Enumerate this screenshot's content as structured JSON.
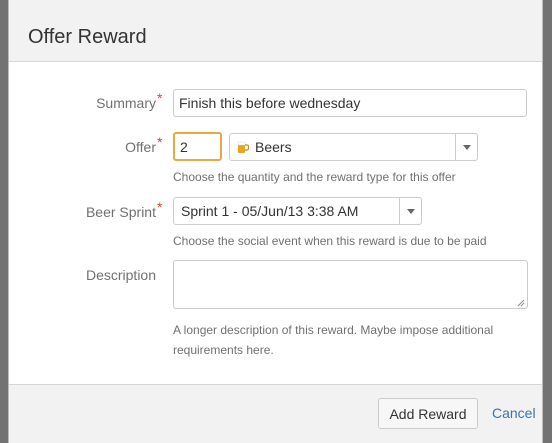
{
  "dialog": {
    "title": "Offer Reward"
  },
  "form": {
    "summary": {
      "label": "Summary",
      "value": "Finish this before wednesday"
    },
    "offer": {
      "label": "Offer",
      "quantity": "2",
      "reward_type": "Beers",
      "reward_icon": "beer-mug-icon",
      "help": "Choose the quantity and the reward type for this offer"
    },
    "beer_sprint": {
      "label": "Beer Sprint",
      "value": "Sprint 1 - 05/Jun/13 3:38 AM",
      "help": "Choose the social event when this reward is due to be paid"
    },
    "description": {
      "label": "Description",
      "value": "",
      "help_line1": "A longer description of this reward. Maybe impose additional",
      "help_line2": "requirements here."
    },
    "required_marker": "*"
  },
  "footer": {
    "submit_label": "Add Reward",
    "cancel_label": "Cancel"
  },
  "colors": {
    "required": "#d04437",
    "link": "#3b73af",
    "focus_border": "#e8a740"
  }
}
